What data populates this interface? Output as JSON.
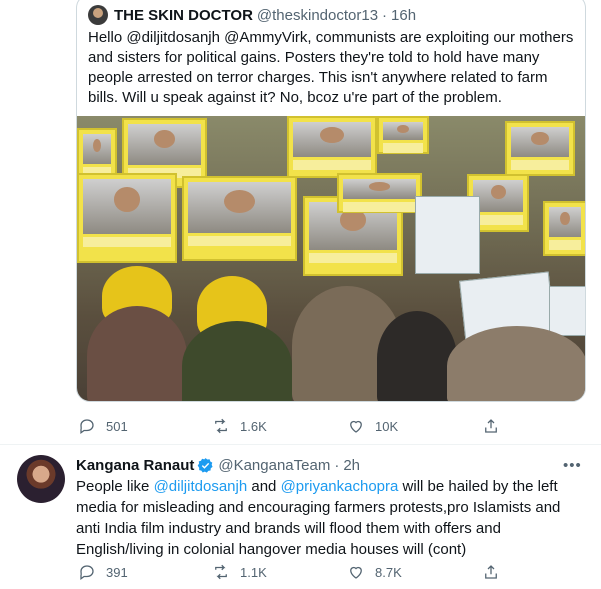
{
  "quoted_tweet": {
    "name": "THE SKIN DOCTOR",
    "handle": "@theskindoctor13",
    "separator": "·",
    "time": "16h",
    "text": "Hello @diljitdosanjh @AmmyVirk, communists are exploiting our mothers and sisters for political gains. Posters they're told to hold have many people arrested on terror charges. This isn't anywhere related to farm bills. Will u speak against it? No, bcoz u're part of the problem.",
    "actions": {
      "replies": "501",
      "retweets": "1.6K",
      "likes": "10K"
    }
  },
  "reply_tweet": {
    "name": "Kangana Ranaut",
    "handle": "@KanganaTeam",
    "separator": "·",
    "time": "2h",
    "more": "•••",
    "text_1": "People like ",
    "mention_1": "@diljitdosanjh",
    "text_2": " and ",
    "mention_2": "@priyankachopra",
    "text_3": " will be hailed by the left media for misleading and encouraging farmers protests,pro Islamists and anti India film industry and brands will flood them with offers and English/living in colonial hangover media houses will (cont)",
    "actions": {
      "replies": "391",
      "retweets": "1.1K",
      "likes": "8.7K"
    }
  },
  "colors": {
    "accent": "#1d9bf0",
    "muted": "#536471",
    "border": "#cfd9de"
  },
  "icons": [
    "reply-icon",
    "retweet-icon",
    "like-icon",
    "share-icon",
    "verified-badge-icon",
    "more-icon"
  ]
}
